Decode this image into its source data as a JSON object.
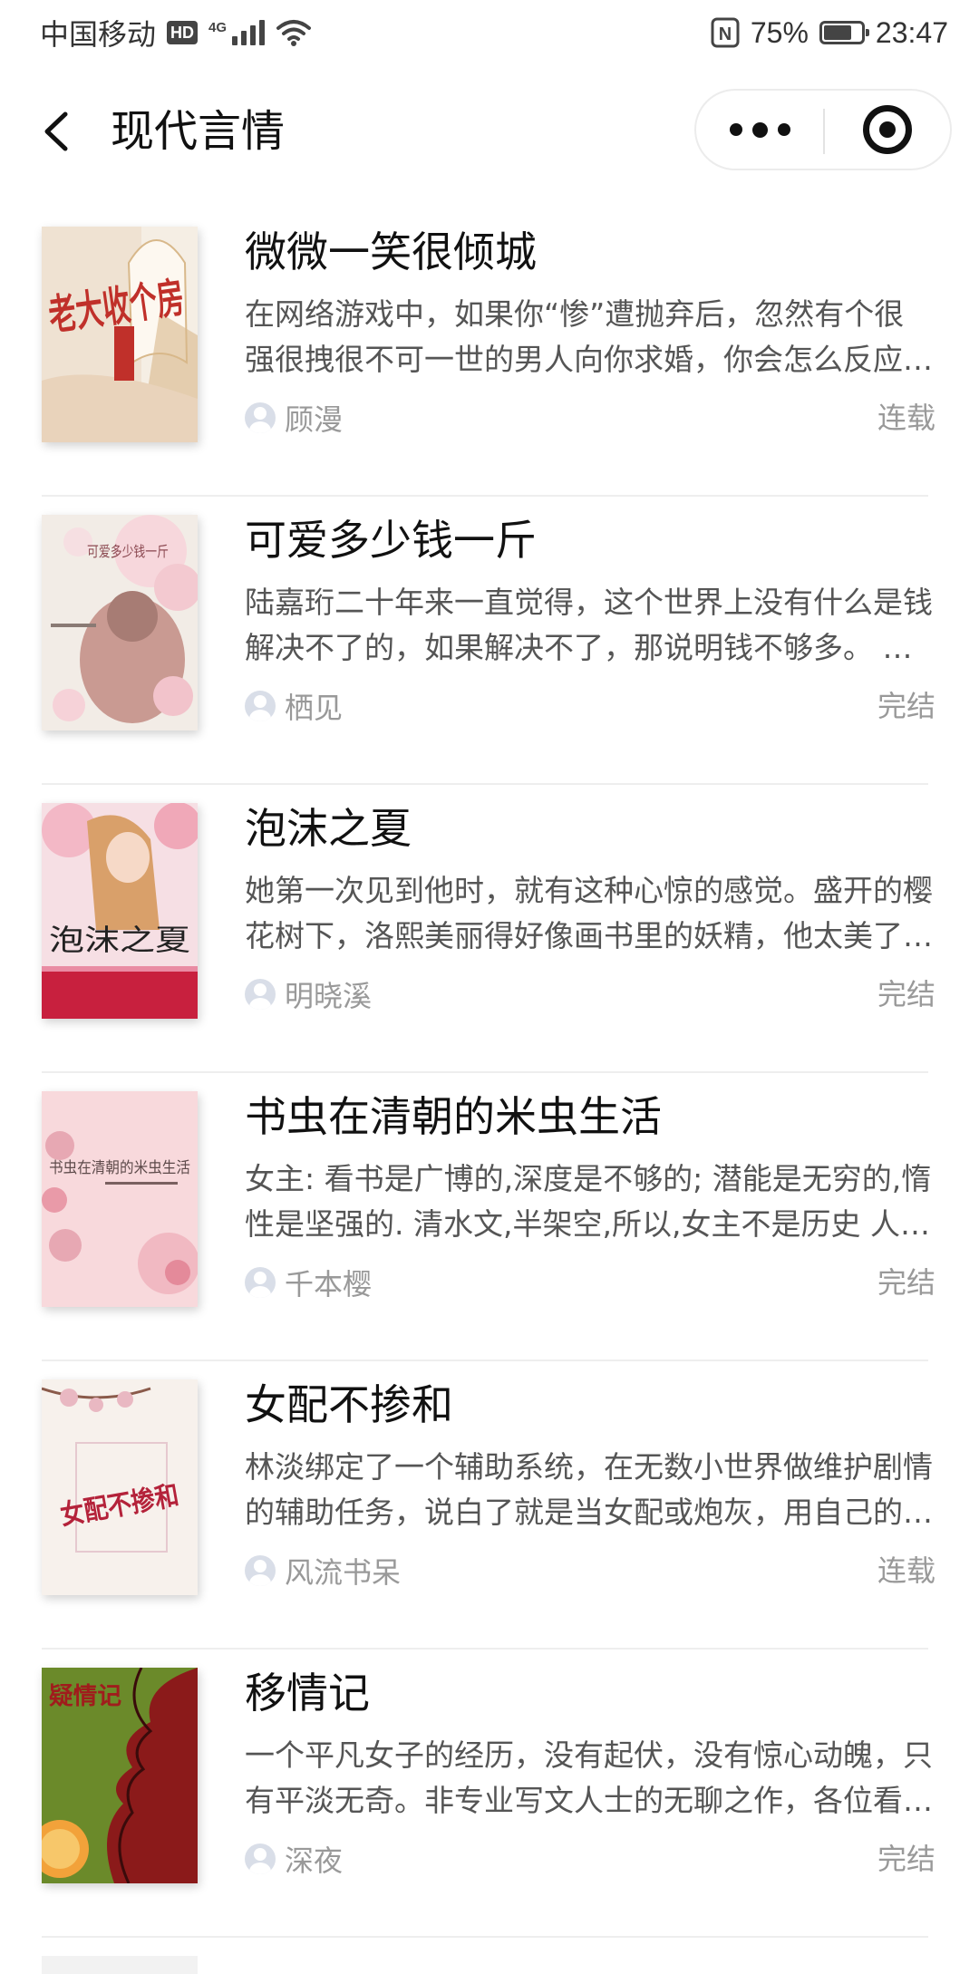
{
  "status_bar": {
    "carrier": "中国移动",
    "hd_badge": "HD",
    "network_type": "4G",
    "nfc_label": "N",
    "battery_percent_text": "75%",
    "battery_level": 0.75,
    "time": "23:47",
    "icons": [
      "signal-icon",
      "wifi-icon",
      "nfc-icon",
      "battery-icon"
    ]
  },
  "nav": {
    "title": "现代言情",
    "back_icon": "chevron-left-icon",
    "more_icon": "more-dots-icon",
    "close_icon": "target-circle-icon"
  },
  "books": [
    {
      "title": "微微一笑很倾城",
      "desc_line1": "在网络游戏中，如果你“惨”遭抛弃后，忽然有个很",
      "desc_line2": "强很拽很不可一世的男人向你求婚，你会怎么反应…",
      "author": "顾漫",
      "status": "连载",
      "cover_text": "老大收个房",
      "cover_colors": [
        "#efe2d2",
        "#c0302a",
        "#d8b88a"
      ]
    },
    {
      "title": "可爱多少钱一斤",
      "desc_line1": "陆嘉珩二十年来一直觉得，这个世界上没有什么是钱",
      "desc_line2": "解决不了的，如果解决不了，那说明钱不够多。 …",
      "author": "栖见",
      "status": "完结",
      "cover_text": "可爱多少钱一斤",
      "cover_colors": [
        "#f2ece6",
        "#c99a92",
        "#a77c74"
      ]
    },
    {
      "title": "泡沫之夏",
      "desc_line1": "她第一次见到他时，就有这种心惊的感觉。盛开的樱",
      "desc_line2": "花树下，洛熙美丽得好像画书里的妖精，他太美了…",
      "author": "明晓溪",
      "status": "完结",
      "cover_text": "泡沫之夏",
      "cover_colors": [
        "#f6dfe4",
        "#c8203e",
        "#e98ba3"
      ]
    },
    {
      "title": "书虫在清朝的米虫生活",
      "desc_line1": "女主: 看书是广博的,深度是不够的; 潜能是无穷的,惰",
      "desc_line2": "性是坚强的. 清水文,半架空,所以,女主不是历史 人…",
      "author": "千本樱",
      "status": "完结",
      "cover_text": "书虫在清朝的米虫生活",
      "cover_colors": [
        "#f8d9dc",
        "#e7a8b3",
        "#5d4a4a"
      ]
    },
    {
      "title": "女配不掺和",
      "desc_line1": "林淡绑定了一个辅助系统，在无数小世界做维护剧情",
      "desc_line2": "的辅助任务，说白了就是当女配或炮灰，用自己的…",
      "author": "风流书呆",
      "status": "连载",
      "cover_text": "女配不掺和",
      "cover_colors": [
        "#f7f1ec",
        "#b4223a",
        "#e9b8c2"
      ]
    },
    {
      "title": "移情记",
      "desc_line1": "一个平凡女子的经历，没有起伏，没有惊心动魄，只",
      "desc_line2": "有平淡无奇。非专业写文人士的无聊之作，各位看…",
      "author": "深夜",
      "status": "完结",
      "cover_text": "疑情记",
      "cover_colors": [
        "#6b8a2a",
        "#8b1a1a",
        "#f2a23a"
      ]
    }
  ]
}
